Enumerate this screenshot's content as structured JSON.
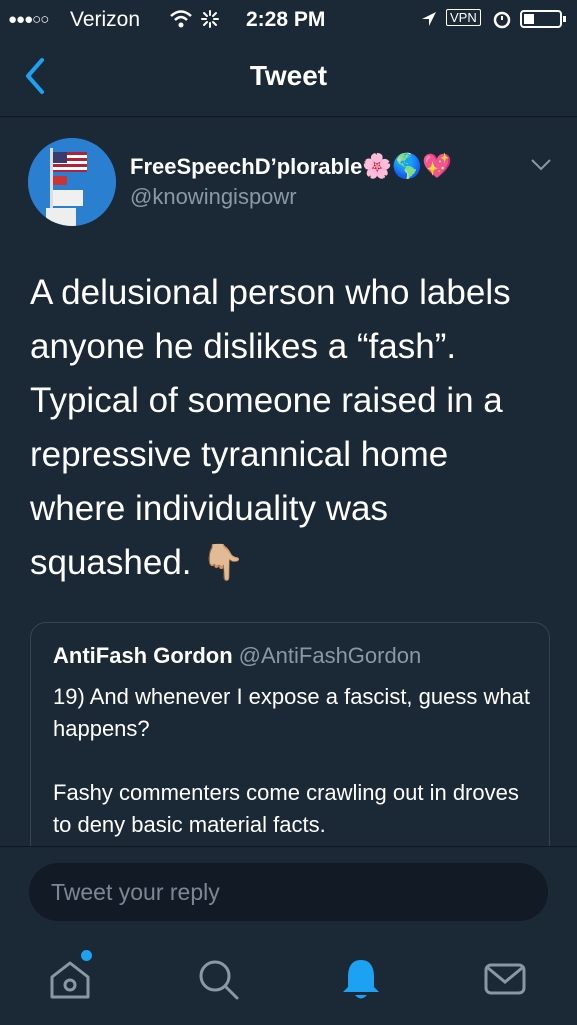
{
  "status_bar": {
    "signal": "●●●○○",
    "carrier": "Verizon",
    "time": "2:28 PM",
    "vpn": "VPN"
  },
  "nav": {
    "title": "Tweet",
    "back_icon": "chevron-left-icon"
  },
  "tweet": {
    "author_name": "FreeSpeechD’plorable",
    "author_emojis": "🌸🌎💖",
    "author_handle": "@knowingispowr",
    "text": "A delusional person who labels anyone he dislikes a “fash”. Typical of someone raised in a repressive tyrannical home where individuality was squashed. 👇🏼"
  },
  "quoted_tweet": {
    "name": "AntiFash Gordon",
    "handle": "@AntiFashGordon",
    "text": "19) And whenever I expose a fascist, guess what happens?\n\nFashy commenters come crawling out in droves to deny basic material facts."
  },
  "reply_box": {
    "placeholder": "Tweet your reply"
  },
  "tab_bar": {
    "items": [
      "home-icon",
      "search-icon",
      "notifications-icon",
      "messages-icon"
    ],
    "active": "notifications-icon"
  },
  "colors": {
    "background": "#1b2836",
    "accent": "#1da1f2",
    "secondary_text": "#8899a6"
  }
}
